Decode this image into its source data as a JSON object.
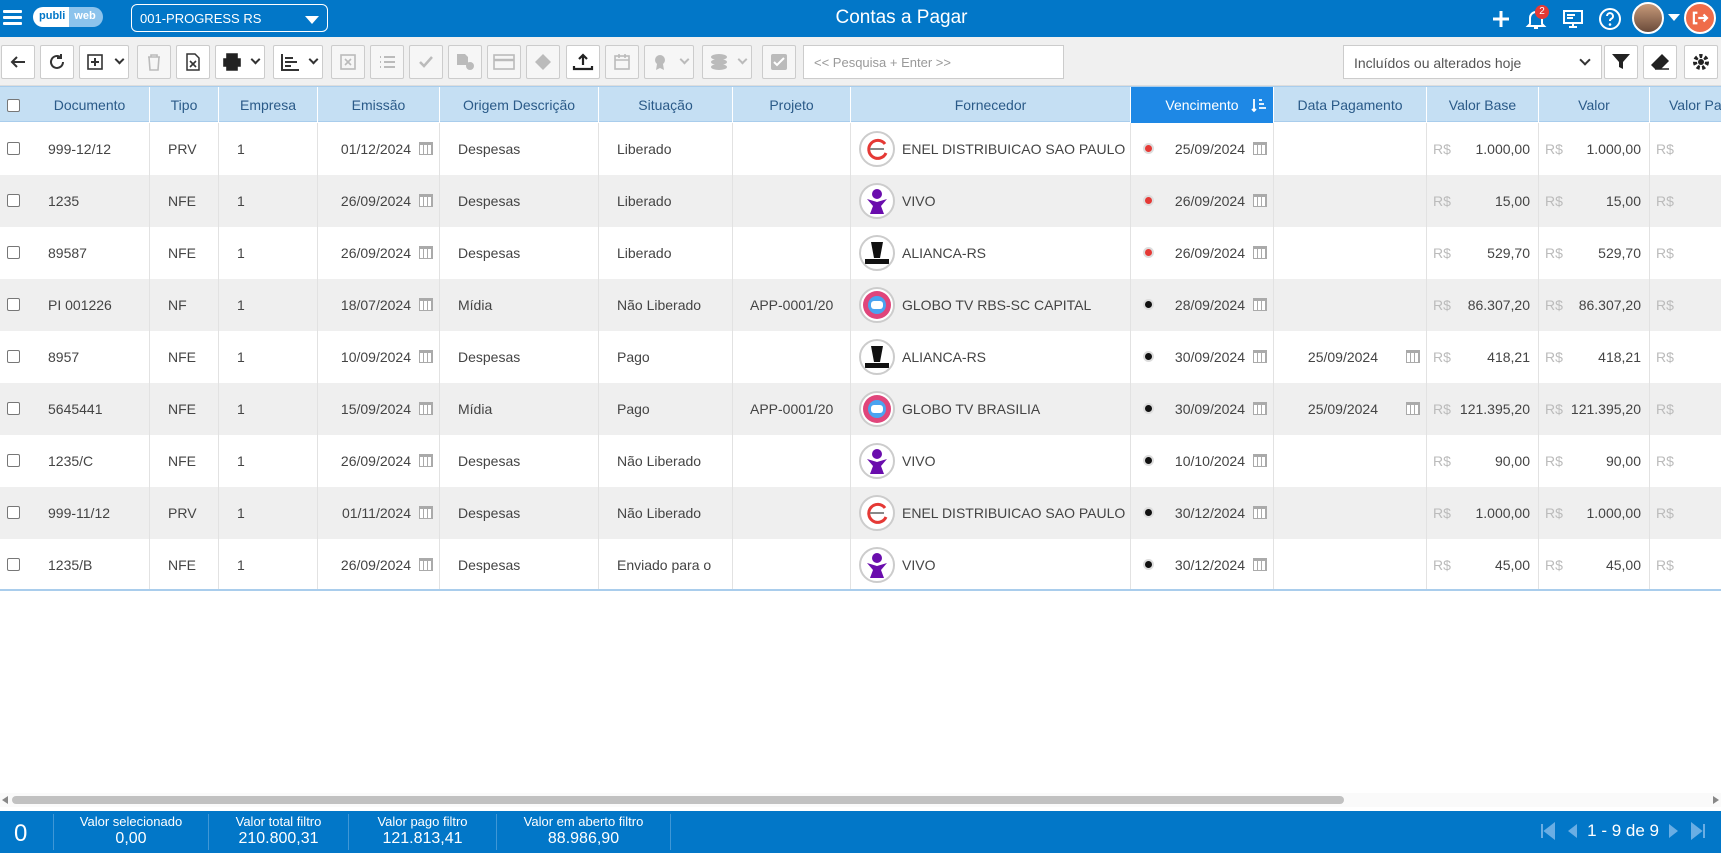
{
  "header": {
    "logo_left": "publi",
    "logo_right": "web",
    "company": "001-PROGRESS RS",
    "title": "Contas a Pagar",
    "notification_count": "2"
  },
  "toolbar": {
    "search_placeholder": "<< Pesquisa + Enter >>",
    "filter_value": "Incluídos ou alterados hoje"
  },
  "columns": [
    "Documento",
    "Tipo",
    "Empresa",
    "Emissão",
    "Origem Descrição",
    "Situação",
    "Projeto",
    "Fornecedor",
    "Vencimento",
    "Data Pagamento",
    "Valor Base",
    "Valor",
    "Valor Pa"
  ],
  "sorted_column": "Vencimento",
  "currency": "R$",
  "rows": [
    {
      "doc": "999-12/12",
      "tipo": "PRV",
      "empresa": "1",
      "emissao": "01/12/2024",
      "origem": "Despesas",
      "situacao": "Liberado",
      "projeto": "",
      "fornecedor": "ENEL DISTRIBUICAO SAO PAULO",
      "supplier_icon": "enel-logo",
      "status_color": "#e53935",
      "vencimento": "25/09/2024",
      "pagamento": "",
      "valor_base": "1.000,00",
      "valor": "1.000,00"
    },
    {
      "doc": "1235",
      "tipo": "NFE",
      "empresa": "1",
      "emissao": "26/09/2024",
      "origem": "Despesas",
      "situacao": "Liberado",
      "projeto": "",
      "fornecedor": "VIVO",
      "supplier_icon": "vivo-logo",
      "status_color": "#e53935",
      "vencimento": "26/09/2024",
      "pagamento": "",
      "valor_base": "15,00",
      "valor": "15,00"
    },
    {
      "doc": "89587",
      "tipo": "NFE",
      "empresa": "1",
      "emissao": "26/09/2024",
      "origem": "Despesas",
      "situacao": "Liberado",
      "projeto": "",
      "fornecedor": "ALIANCA-RS",
      "supplier_icon": "alianca-logo",
      "status_color": "#e53935",
      "vencimento": "26/09/2024",
      "pagamento": "",
      "valor_base": "529,70",
      "valor": "529,70"
    },
    {
      "doc": "PI 001226",
      "tipo": "NF",
      "empresa": "1",
      "emissao": "18/07/2024",
      "origem": "Mídia",
      "situacao": "Não Liberado",
      "projeto": "APP-0001/20",
      "fornecedor": "GLOBO TV RBS-SC CAPITAL",
      "supplier_icon": "globo-logo",
      "status_color": "#111111",
      "vencimento": "28/09/2024",
      "pagamento": "",
      "valor_base": "86.307,20",
      "valor": "86.307,20"
    },
    {
      "doc": "8957",
      "tipo": "NFE",
      "empresa": "1",
      "emissao": "10/09/2024",
      "origem": "Despesas",
      "situacao": "Pago",
      "projeto": "",
      "fornecedor": "ALIANCA-RS",
      "supplier_icon": "alianca-logo",
      "status_color": "#111111",
      "vencimento": "30/09/2024",
      "pagamento": "25/09/2024",
      "valor_base": "418,21",
      "valor": "418,21"
    },
    {
      "doc": "5645441",
      "tipo": "NFE",
      "empresa": "1",
      "emissao": "15/09/2024",
      "origem": "Mídia",
      "situacao": "Pago",
      "projeto": "APP-0001/20",
      "fornecedor": "GLOBO TV BRASILIA",
      "supplier_icon": "globo-logo",
      "status_color": "#111111",
      "vencimento": "30/09/2024",
      "pagamento": "25/09/2024",
      "valor_base": "121.395,20",
      "valor": "121.395,20"
    },
    {
      "doc": "1235/C",
      "tipo": "NFE",
      "empresa": "1",
      "emissao": "26/09/2024",
      "origem": "Despesas",
      "situacao": "Não Liberado",
      "projeto": "",
      "fornecedor": "VIVO",
      "supplier_icon": "vivo-logo",
      "status_color": "#111111",
      "vencimento": "10/10/2024",
      "pagamento": "",
      "valor_base": "90,00",
      "valor": "90,00"
    },
    {
      "doc": "999-11/12",
      "tipo": "PRV",
      "empresa": "1",
      "emissao": "01/11/2024",
      "origem": "Despesas",
      "situacao": "Não Liberado",
      "projeto": "",
      "fornecedor": "ENEL DISTRIBUICAO SAO PAULO",
      "supplier_icon": "enel-logo",
      "status_color": "#111111",
      "vencimento": "30/12/2024",
      "pagamento": "",
      "valor_base": "1.000,00",
      "valor": "1.000,00"
    },
    {
      "doc": "1235/B",
      "tipo": "NFE",
      "empresa": "1",
      "emissao": "26/09/2024",
      "origem": "Despesas",
      "situacao": "Enviado para o",
      "projeto": "",
      "fornecedor": "VIVO",
      "supplier_icon": "vivo-logo",
      "status_color": "#111111",
      "vencimento": "30/12/2024",
      "pagamento": "",
      "valor_base": "45,00",
      "valor": "45,00"
    }
  ],
  "footer": {
    "selected_count": "0",
    "valor_selecionado_label": "Valor selecionado",
    "valor_selecionado": "0,00",
    "valor_total_label": "Valor total filtro",
    "valor_total": "210.800,31",
    "valor_pago_label": "Valor pago filtro",
    "valor_pago": "121.813,41",
    "valor_aberto_label": "Valor em aberto filtro",
    "valor_aberto": "88.986,90",
    "pagination": "1 - 9 de 9"
  }
}
